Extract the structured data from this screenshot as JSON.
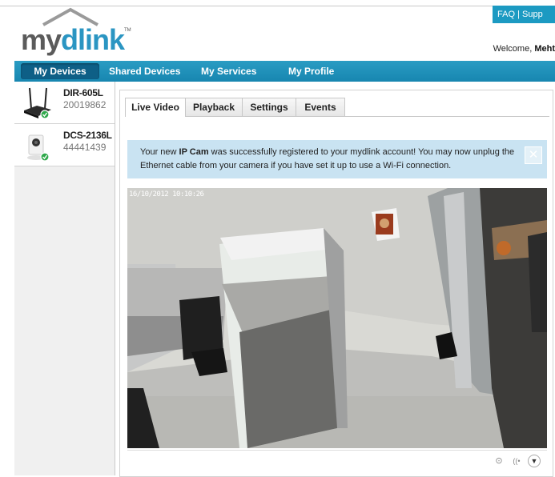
{
  "header": {
    "links": [
      "FAQ",
      "Supp"
    ],
    "link_separator": "|",
    "logo_my": "my",
    "logo_dlink": "dlink",
    "logo_tm": "TM",
    "welcome_prefix": "Welcome,",
    "welcome_user": "Meht"
  },
  "nav": {
    "items": [
      {
        "label": "My Devices",
        "active": true
      },
      {
        "label": "Shared Devices"
      },
      {
        "label": "My Services"
      },
      {
        "label": "My Profile"
      }
    ]
  },
  "devices": [
    {
      "name": "DIR-605L",
      "id": "20019862",
      "icon": "router-icon",
      "status": "online"
    },
    {
      "name": "DCS-2136L",
      "id": "44441439",
      "icon": "camera-icon",
      "status": "online"
    }
  ],
  "tabs": [
    {
      "label": "Live Video",
      "active": true
    },
    {
      "label": "Playback"
    },
    {
      "label": "Settings"
    },
    {
      "label": "Events"
    }
  ],
  "banner": {
    "text_before": "Your new ",
    "text_bold": "IP Cam",
    "text_after": " was successfully registered to your mydlink account! You may now unplug the Ethernet cable from your camera if you have set it up to use a Wi-Fi connection.",
    "close_glyph": "✕"
  },
  "video": {
    "timestamp": "16/10/2012 10:10:26"
  },
  "controls": {
    "record_glyph": "⊙",
    "audio_glyph": "((•",
    "menu_glyph": "▼"
  },
  "colors": {
    "brand_blue": "#1c9ac2",
    "nav_active": "#0e5f86",
    "banner_bg": "#c9e3f2",
    "status_green": "#2ea84a"
  }
}
